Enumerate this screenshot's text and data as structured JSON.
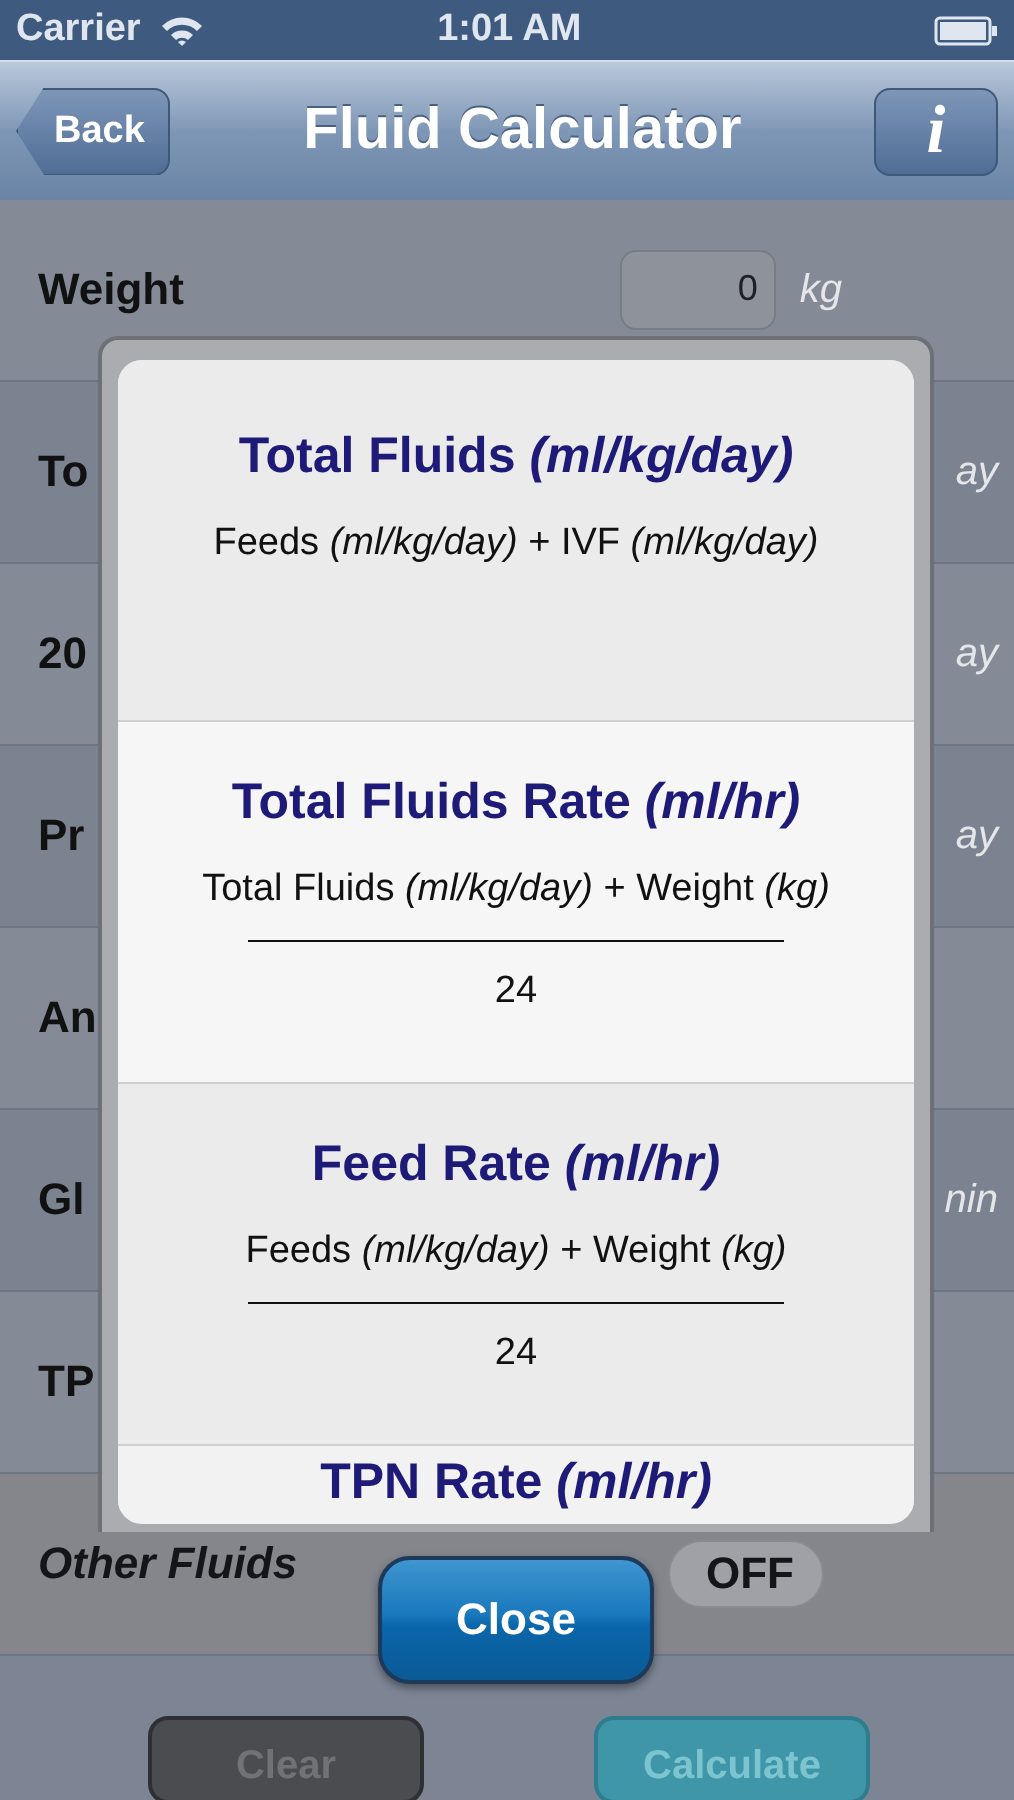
{
  "status_bar": {
    "carrier": "Carrier",
    "time": "1:01 AM"
  },
  "nav_bar": {
    "back": "Back",
    "title": "Fluid Calculator",
    "info": "i"
  },
  "form": {
    "weight": {
      "label": "Weight",
      "value": "0",
      "unit": "kg"
    },
    "rows": [
      {
        "label": "To",
        "unit": "ay"
      },
      {
        "label": "20",
        "unit": "ay"
      },
      {
        "label": "Pr",
        "unit": "ay"
      },
      {
        "label": "An"
      },
      {
        "label": "Gl",
        "unit": "nin"
      },
      {
        "label": "TP"
      }
    ],
    "other_fluids": {
      "label": "Other Fluids",
      "switch": {
        "label": "OFF",
        "on": false
      }
    }
  },
  "buttons": [
    {
      "label": "Clear",
      "kind": "secondary"
    },
    {
      "label": "Calculate",
      "kind": "primary"
    }
  ],
  "dialog": {
    "sections": [
      {
        "kind": "sum",
        "title": "Total Fluids *(ml/kg/day)*",
        "formula": "Feeds *(ml/kg/day)* + IVF *(ml/kg/day)*"
      },
      {
        "kind": "fraction",
        "title": "Total Fluids Rate *(ml/hr)*",
        "numerator": "Total Fluids *(ml/kg/day)* + Weight *(kg)*",
        "denominator": "24"
      },
      {
        "kind": "fraction",
        "title": "Feed Rate *(ml/hr)*",
        "numerator": "Feeds *(ml/kg/day)* + Weight *(kg)*",
        "denominator": "24"
      },
      {
        "kind": "title_only",
        "title": "TPN Rate *(ml/hr)*"
      }
    ],
    "close": "Close"
  }
}
